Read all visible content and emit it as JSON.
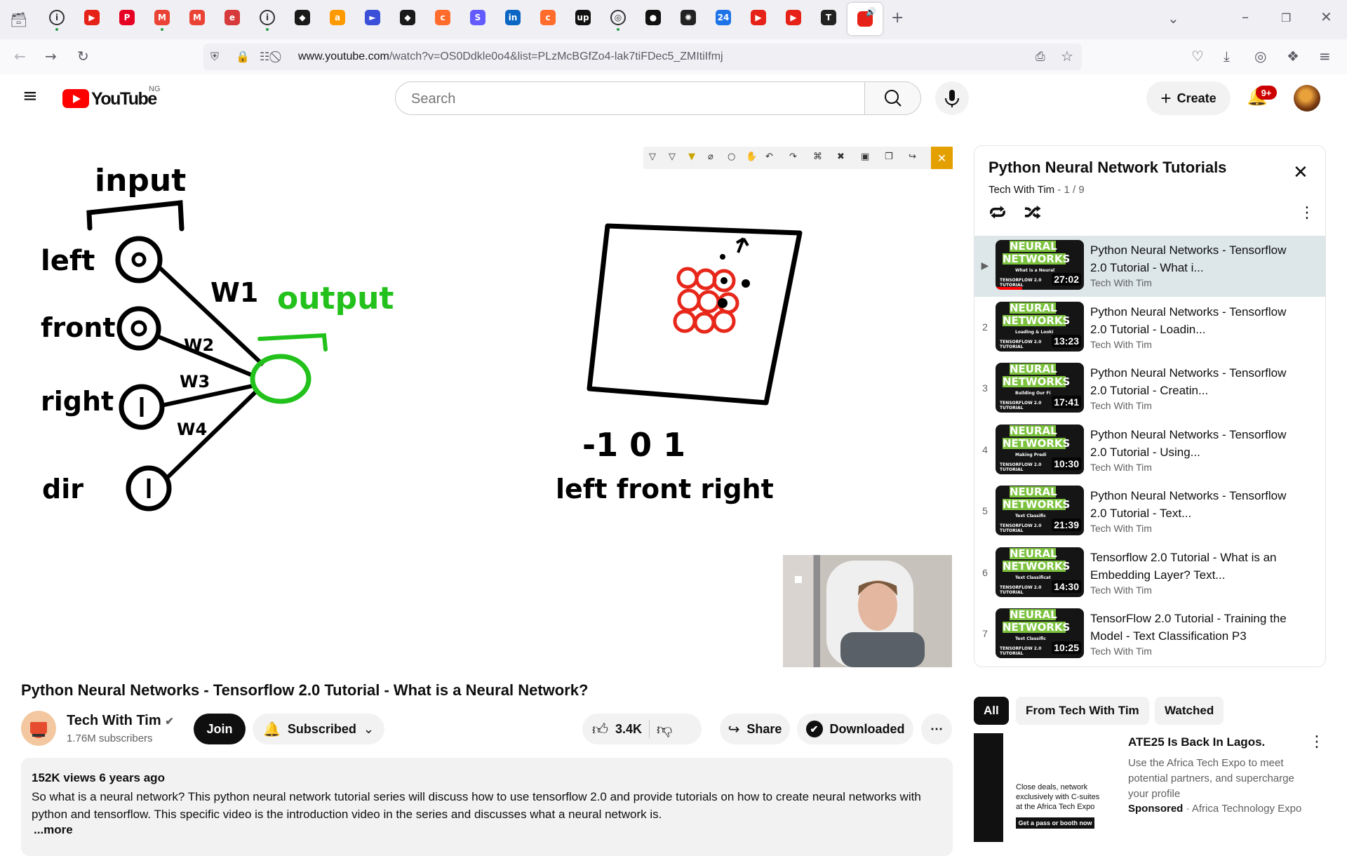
{
  "browser": {
    "url_host": "www.youtube.com",
    "url_path": "/watch?v=OS0Ddkle0o4&list=PLzMcBGfZo4-lak7tiFDec5_ZMItiIfmj",
    "tab_icons": [
      "info-icon",
      "youtube-icon",
      "pinterest-icon",
      "gmail-icon",
      "gmail-icon",
      "edge-icon",
      "info-icon",
      "shield-icon",
      "amazon-icon",
      "arrow-icon",
      "shield-icon",
      "cpanel-icon",
      "stripe-icon",
      "linkedin-icon",
      "cpanel-icon",
      "upwork-icon",
      "globe-icon",
      "github-icon",
      "openai-icon",
      "news-icon",
      "youtube-icon",
      "youtube-icon",
      "app-icon",
      "youtube-icon"
    ],
    "new_tab": "+"
  },
  "header": {
    "logo_text": "YouTube",
    "country": "NG",
    "search_placeholder": "Search",
    "create_label": "Create",
    "notif_count": "9+"
  },
  "video": {
    "whiteboard": {
      "input": "input",
      "output": "output",
      "labels": [
        "left",
        "front",
        "right",
        "dir"
      ],
      "weights": [
        "W1",
        "W2",
        "W3",
        "W4"
      ],
      "scale": "-1 0 1",
      "scale_labels": "left front right"
    },
    "title": "Python Neural Networks - Tensorflow 2.0 Tutorial - What is a Neural Network?",
    "channel": "Tech With Tim",
    "subscribers": "1.76M subscribers",
    "join_label": "Join",
    "subscribed_label": "Subscribed",
    "likes": "3.4K",
    "share_label": "Share",
    "downloaded_label": "Downloaded",
    "views_date": "152K views  6 years ago",
    "description": "So what is a neural network? This python neural network tutorial series will discuss how to use tensorflow 2.0 and provide tutorials on how to create neural networks with python and tensorflow. This specific video is the introduction video in the series and discusses what a neural network is.",
    "more_label": "...more"
  },
  "playlist": {
    "title": "Python Neural Network Tutorials",
    "channel": "Tech With Tim",
    "position": " - 1 / 9",
    "items": [
      {
        "idx": "▶",
        "title": "Python Neural Networks - Tensorflow 2.0 Tutorial - What i...",
        "channel": "Tech With Tim",
        "duration": "27:02",
        "sub": "What is a Neural",
        "watched": 0.3
      },
      {
        "idx": "2",
        "title": "Python Neural Networks - Tensorflow 2.0 Tutorial - Loadin...",
        "channel": "Tech With Tim",
        "duration": "13:23",
        "sub": "Loading & Looki",
        "watched": 0
      },
      {
        "idx": "3",
        "title": "Python Neural Networks - Tensorflow 2.0 Tutorial - Creatin...",
        "channel": "Tech With Tim",
        "duration": "17:41",
        "sub": "Building Our Fi",
        "watched": 0
      },
      {
        "idx": "4",
        "title": "Python Neural Networks - Tensorflow 2.0 Tutorial - Using...",
        "channel": "Tech With Tim",
        "duration": "10:30",
        "sub": "Making Predi",
        "watched": 0
      },
      {
        "idx": "5",
        "title": "Python Neural Networks - Tensorflow 2.0 Tutorial - Text...",
        "channel": "Tech With Tim",
        "duration": "21:39",
        "sub": "Text Classific",
        "watched": 0
      },
      {
        "idx": "6",
        "title": "Tensorflow 2.0 Tutorial - What is an Embedding Layer? Text...",
        "channel": "Tech With Tim",
        "duration": "14:30",
        "sub": "Text Classificat",
        "watched": 0
      },
      {
        "idx": "7",
        "title": "TensorFlow 2.0 Tutorial - Training the Model - Text Classification P3",
        "channel": "Tech With Tim",
        "duration": "10:25",
        "sub": "Text Classific",
        "watched": 0
      }
    ],
    "thumb_line1": "NEURAL",
    "thumb_line2": "NETWORKS",
    "thumb_footer": "TENSORFLOW 2.0 TUTORIAL"
  },
  "chips": [
    "All",
    "From Tech With Tim",
    "Watched"
  ],
  "ad": {
    "title": "ATE25 Is Back In Lagos.",
    "text": "Use the Africa Tech Expo to meet potential partners, and supercharge your profile",
    "sponsored": "Sponsored",
    "advertiser": " · Africa Technology Expo",
    "thumb_text": "Close deals, network exclusively with C-suites at the Africa Tech Expo",
    "thumb_cta": "Get a pass or booth now"
  }
}
